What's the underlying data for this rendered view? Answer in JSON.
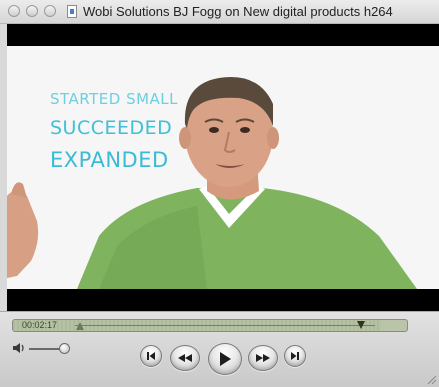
{
  "window": {
    "title": "Wobi Solutions BJ Fogg on New digital products h264"
  },
  "video": {
    "overlay_text": [
      "STARTED SMALL",
      "SUCCEEDED",
      "EXPANDED"
    ]
  },
  "controls": {
    "current_time": "00:02:17",
    "playhead_fraction": 0.87,
    "volume_fraction": 1.0
  },
  "icons": {
    "close": "close-icon",
    "minimize": "minimize-icon",
    "zoom": "zoom-icon",
    "document": "document-icon",
    "volume": "speaker-icon",
    "previous": "skip-back-icon",
    "rewind": "rewind-icon",
    "play": "play-icon",
    "fast_forward": "fast-forward-icon",
    "next": "skip-forward-icon"
  },
  "colors": {
    "overlay_text": "#40bfd9",
    "scrubber_bg": "#b9c4a9",
    "letterbox": "#000000"
  }
}
